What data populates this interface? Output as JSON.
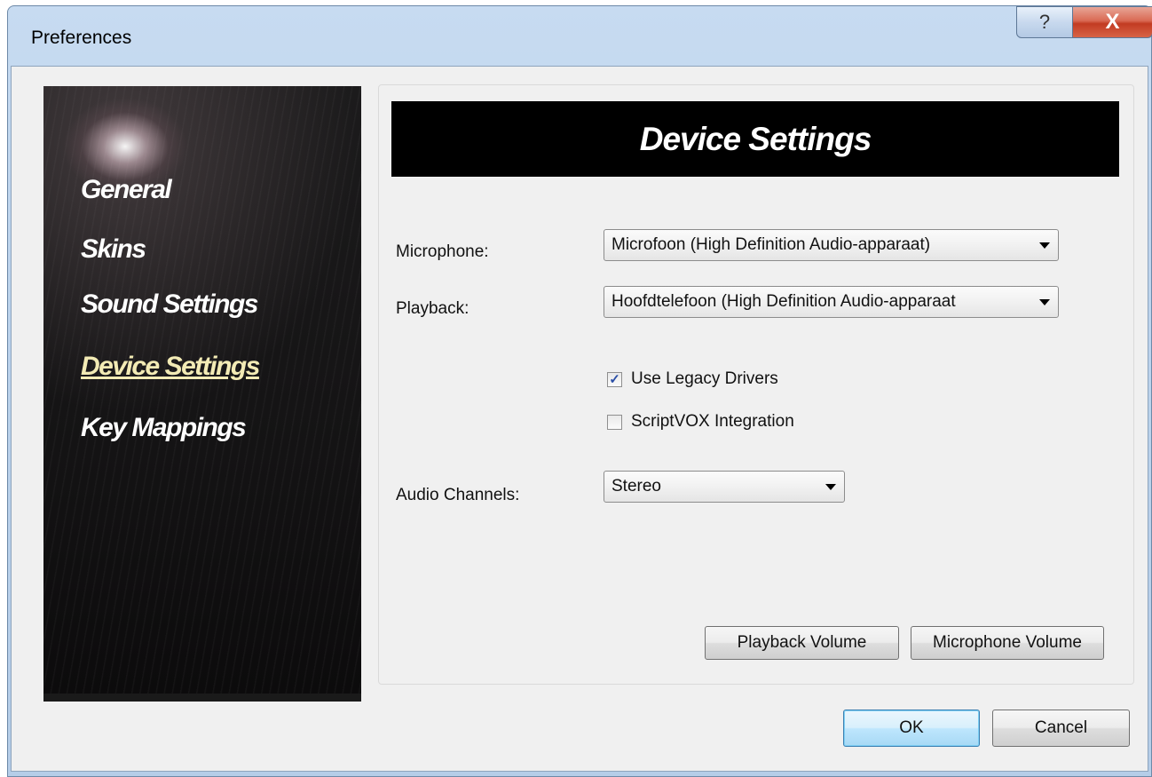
{
  "window": {
    "title": "Preferences",
    "help_glyph": "?",
    "close_glyph": "X"
  },
  "sidebar": {
    "items": [
      {
        "label": "General",
        "active": false
      },
      {
        "label": "Skins",
        "active": false
      },
      {
        "label": "Sound Settings",
        "active": false
      },
      {
        "label": "Device Settings",
        "active": true
      },
      {
        "label": "Key Mappings",
        "active": false
      }
    ]
  },
  "panel": {
    "header": "Device Settings",
    "microphone": {
      "label": "Microphone:",
      "value": "Microfoon (High Definition Audio-apparaat)"
    },
    "playback": {
      "label": "Playback:",
      "value": "Hoofdtelefoon (High Definition Audio-apparaat"
    },
    "legacy_drivers": {
      "label": "Use Legacy Drivers",
      "checked": true
    },
    "scriptvox": {
      "label": "ScriptVOX Integration",
      "checked": false
    },
    "audio_channels": {
      "label": "Audio Channels:",
      "value": "Stereo"
    },
    "playback_volume_label": "Playback Volume",
    "microphone_volume_label": "Microphone Volume"
  },
  "footer": {
    "ok_label": "OK",
    "cancel_label": "Cancel"
  },
  "icons": {
    "check_glyph": "✓",
    "help": "help-icon",
    "close": "close-icon",
    "dropdown": "chevron-down-icon"
  },
  "colors": {
    "active_nav": "#f3ebb5",
    "default_button": "#bee6fd",
    "close_button": "#c23b22"
  }
}
